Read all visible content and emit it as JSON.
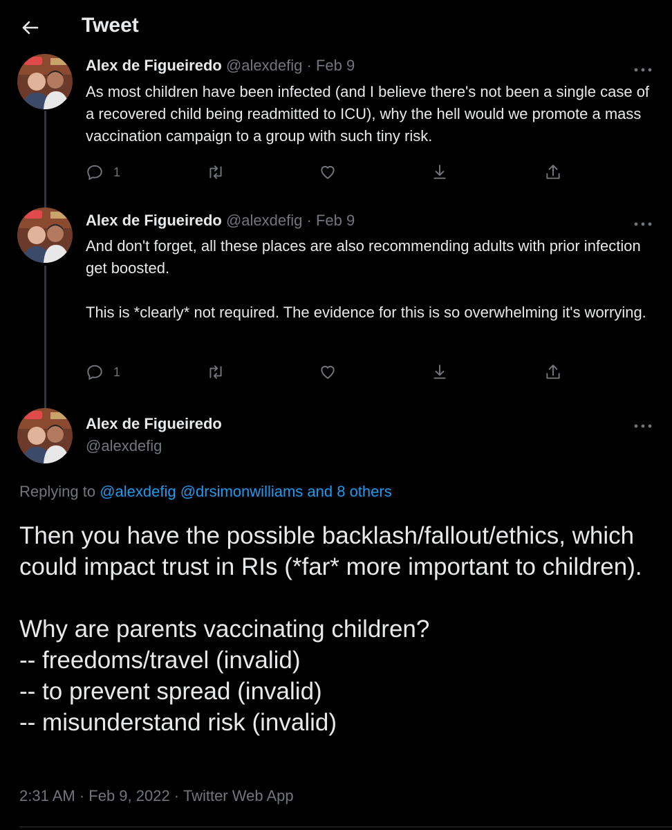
{
  "header": {
    "title": "Tweet",
    "back_icon": "arrow-left-icon"
  },
  "thread": [
    {
      "author_name": "Alex de Figueiredo",
      "handle": "@alexdefig",
      "separator": "·",
      "date": "Feb 9",
      "text": "As most children have been infected (and I believe there's not been a single case of a recovered child being readmitted to ICU), why the hell would we promote a mass vaccination campaign to a group with such tiny risk.",
      "reply_count": "1"
    },
    {
      "author_name": "Alex de Figueiredo",
      "handle": "@alexdefig",
      "separator": "·",
      "date": "Feb 9",
      "text": "And don't forget, all these places are also recommending adults with prior infection get boosted.\n\nThis is *clearly* not required. The evidence for this is so overwhelming it's worrying.",
      "reply_count": "1"
    }
  ],
  "main_tweet": {
    "author_name": "Alex de Figueiredo",
    "handle": "@alexdefig",
    "replying_prefix": "Replying to",
    "replying_links": "@alexdefig @drsimonwilliams and 8 others",
    "text": "Then you have the possible backlash/fallout/ethics, which could impact trust in RIs (*far* more important to children).\n\nWhy are parents vaccinating children?\n-- freedoms/travel (invalid)\n-- to prevent spread (invalid)\n-- misunderstand risk (invalid)",
    "meta": "2:31 AM · Feb 9, 2022 · Twitter Web App"
  },
  "colors": {
    "background": "#000000",
    "text": "#e7e9ea",
    "muted": "#71767b",
    "link": "#1d9bf0"
  }
}
